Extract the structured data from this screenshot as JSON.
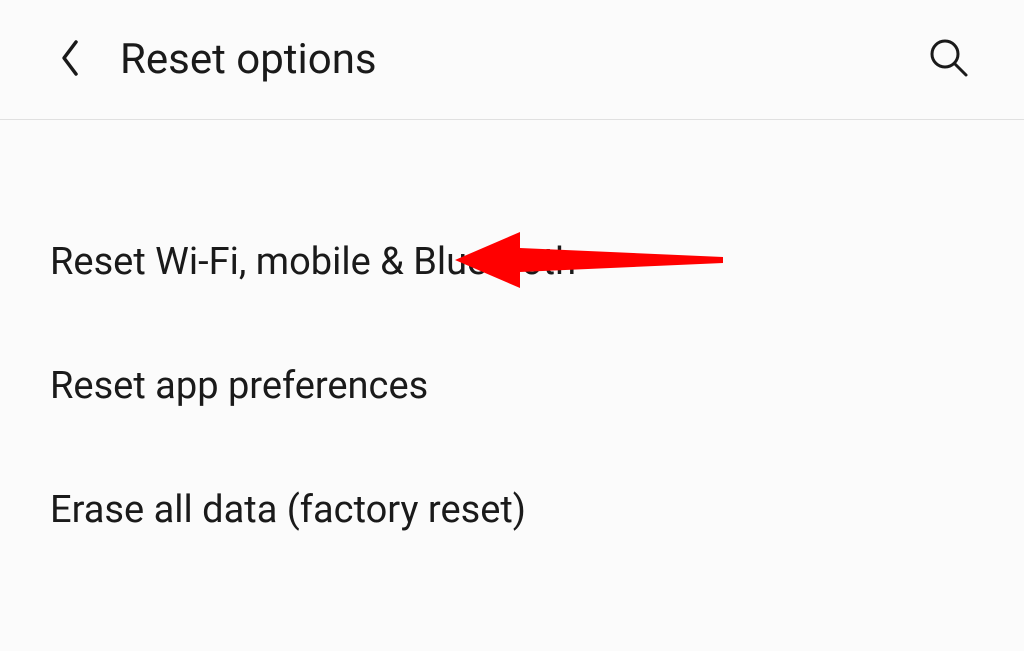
{
  "header": {
    "title": "Reset options"
  },
  "options": {
    "items": [
      {
        "label": "Reset Wi-Fi, mobile & Bluetooth",
        "highlighted": true
      },
      {
        "label": "Reset app preferences",
        "highlighted": false
      },
      {
        "label": "Erase all data (factory reset)",
        "highlighted": false
      }
    ]
  }
}
